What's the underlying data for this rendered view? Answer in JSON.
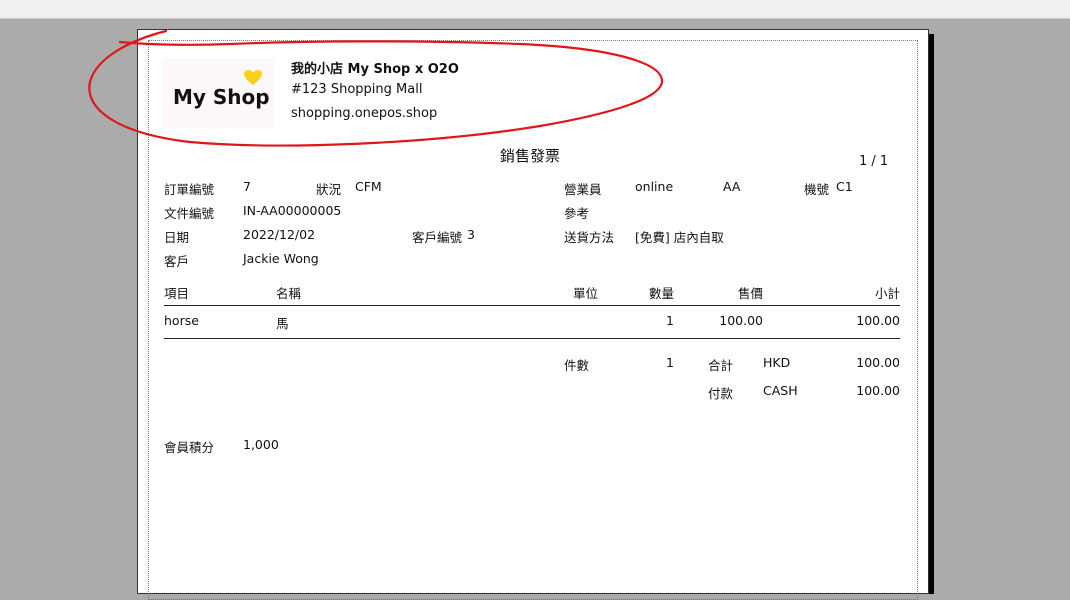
{
  "shop": {
    "logo_text": "My Shop",
    "name": "我的小店 My Shop x O2O",
    "address": "#123 Shopping Mall",
    "website": "shopping.onepos.shop"
  },
  "invoice": {
    "title": "銷售發票",
    "page": "1 /   1",
    "fields": {
      "order_no_label": "訂單編號",
      "order_no": "7",
      "status_label": "狀況",
      "status": "CFM",
      "salesperson_label": "營業員",
      "salesperson": "online",
      "salesperson_code": "AA",
      "machine_label": "機號",
      "machine": "C1",
      "doc_no_label": "文件編號",
      "doc_no": "IN-AA00000005",
      "ref_label": "參考",
      "date_label": "日期",
      "date": "2022/12/02",
      "customer_no_label": "客戶編號",
      "customer_no": "3",
      "delivery_label": "送貨方法",
      "delivery": "[免費] 店內自取",
      "customer_label": "客戶",
      "customer": "Jackie Wong"
    },
    "table": {
      "headers": {
        "item": "項目",
        "name": "名稱",
        "unit": "單位",
        "qty": "數量",
        "price": "售價",
        "subtotal": "小計"
      },
      "rows": [
        {
          "item": "horse",
          "name": "馬",
          "unit": "",
          "qty": "1",
          "price": "100.00",
          "subtotal": "100.00"
        }
      ]
    },
    "summary": {
      "count_label": "件數",
      "count": "1",
      "total_label": "合計",
      "currency": "HKD",
      "total": "100.00",
      "payment_label": "付款",
      "payment_method": "CASH",
      "payment": "100.00"
    },
    "points_label": "會員積分",
    "points": "1,000"
  },
  "colors": {
    "annotation": "#e0161b",
    "logo_heart": "#f7d117",
    "background": "#ababab"
  }
}
